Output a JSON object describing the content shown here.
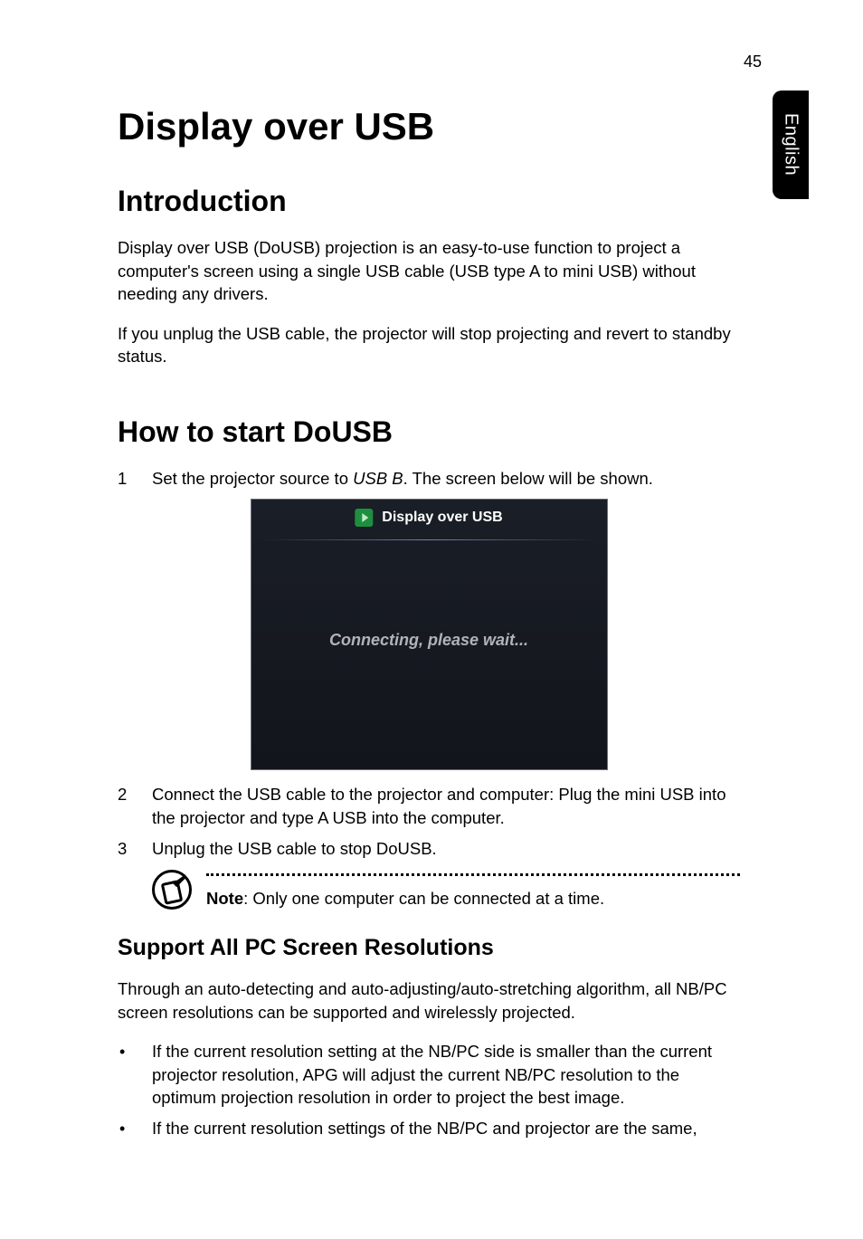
{
  "page_number": "45",
  "side_tab": "English",
  "main_title": "Display over USB",
  "intro": {
    "heading": "Introduction",
    "p1": "Display over USB (DoUSB) projection is an easy-to-use function to project a computer's screen using a single USB cable (USB type A to mini USB) without needing any drivers.",
    "p2": "If you unplug the USB cable, the projector will stop projecting and revert to standby status."
  },
  "start": {
    "heading": "How to start DoUSB",
    "steps": [
      {
        "num": "1",
        "pre": "Set the projector source to ",
        "italic": "USB B",
        "post": ". The screen below will be shown."
      },
      {
        "num": "2",
        "text": "Connect the USB cable to the projector and computer: Plug the mini USB into the projector and type A USB into the computer."
      },
      {
        "num": "3",
        "text": "Unplug the USB cable to stop DoUSB."
      }
    ],
    "screenshot": {
      "title": "Display over USB",
      "message": "Connecting, please wait..."
    },
    "note_label": "Note",
    "note_text": ": Only one computer can be connected at a time."
  },
  "support": {
    "heading": "Support All PC Screen Resolutions",
    "p1": "Through an auto-detecting and auto-adjusting/auto-stretching algorithm, all NB/PC screen resolutions can be supported and wirelessly projected.",
    "bullets": [
      "If the current resolution setting at the NB/PC side is smaller than the current projector resolution, APG will adjust the current NB/PC resolution to the optimum projection resolution in order to project the best image.",
      "If the current resolution settings of the NB/PC and projector are the same,"
    ]
  }
}
